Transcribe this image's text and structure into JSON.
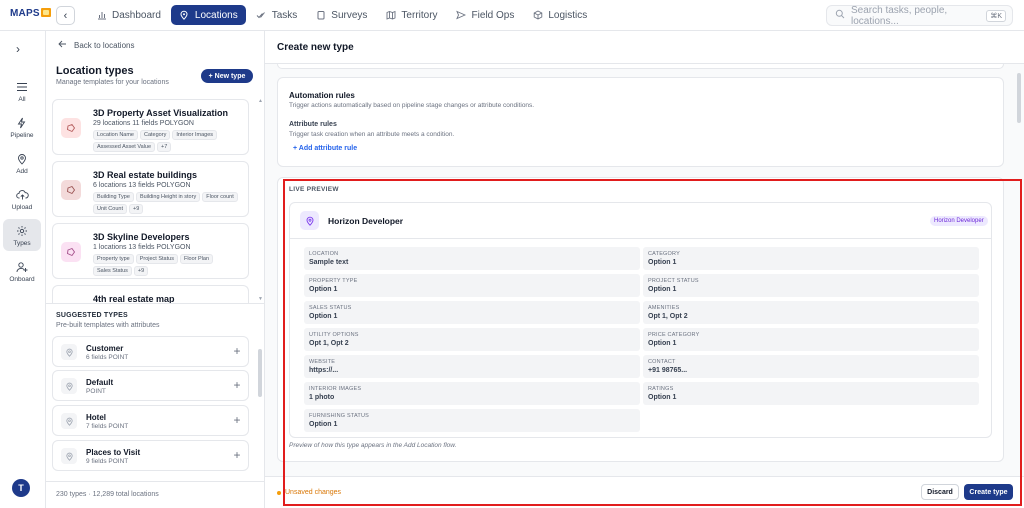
{
  "topbar": {
    "logo": "MAPS",
    "nav": [
      {
        "label": "Dashboard",
        "icon": "bar-chart-icon",
        "active": false
      },
      {
        "label": "Locations",
        "icon": "map-pin-icon",
        "active": true
      },
      {
        "label": "Tasks",
        "icon": "check-icon",
        "active": false
      },
      {
        "label": "Surveys",
        "icon": "clipboard-icon",
        "active": false
      },
      {
        "label": "Territory",
        "icon": "map-icon",
        "active": false
      },
      {
        "label": "Field Ops",
        "icon": "send-icon",
        "active": false
      },
      {
        "label": "Logistics",
        "icon": "box-icon",
        "active": false
      }
    ],
    "search_placeholder": "Search tasks, people, locations...",
    "search_shortcut": "⌘K"
  },
  "rail": {
    "items": [
      {
        "label": "All",
        "icon": "list-icon"
      },
      {
        "label": "Pipeline",
        "icon": "lightning-icon"
      },
      {
        "label": "Add",
        "icon": "map-pin-icon"
      },
      {
        "label": "Upload",
        "icon": "cloud-upload-icon"
      },
      {
        "label": "Types",
        "icon": "gear-icon",
        "active": true
      },
      {
        "label": "Onboard",
        "icon": "user-add-icon"
      }
    ],
    "avatar_initial": "T"
  },
  "left_panel": {
    "back_label": "Back to locations",
    "title": "Location types",
    "subtitle": "Manage templates for your locations",
    "new_type_label": "+ New type",
    "types": [
      {
        "name": "3D Property Asset Visualization",
        "meta": "29 locations  11 fields  POLYGON",
        "tags": [
          "Location Name",
          "Category",
          "Interior Images",
          "Assessed Asset Value",
          "+7"
        ],
        "icon_bg": "#fde2e2"
      },
      {
        "name": "3D Real estate buildings",
        "meta": "6 locations  13 fields  POLYGON",
        "tags": [
          "Building Type",
          "Building Height in story",
          "Floor count",
          "Unit Count",
          "+9"
        ],
        "icon_bg": "#f3dada"
      },
      {
        "name": "3D Skyline Developers",
        "meta": "1 locations  13 fields  POLYGON",
        "tags": [
          "Property type",
          "Project Status",
          "Floor Plan",
          "Sales Status",
          "+9"
        ],
        "icon_bg": "#fbe1f3"
      },
      {
        "name": "4th real estate map",
        "meta": "",
        "tags": [],
        "icon_bg": "#ffffff"
      }
    ],
    "suggested_title": "SUGGESTED TYPES",
    "suggested_subtitle": "Pre-built templates with attributes",
    "suggested": [
      {
        "name": "Customer",
        "meta": "6 fields  POINT"
      },
      {
        "name": "Default",
        "meta": "POINT"
      },
      {
        "name": "Hotel",
        "meta": "7 fields  POINT"
      },
      {
        "name": "Places to Visit",
        "meta": "9 fields  POINT"
      }
    ],
    "footer": "230 types · 12,289 total locations"
  },
  "main": {
    "title": "Create new type",
    "automation": {
      "title": "Automation rules",
      "description": "Trigger actions automatically based on pipeline stage changes or attribute conditions.",
      "attr_title": "Attribute rules",
      "attr_description": "Trigger task creation when an attribute meets a condition.",
      "add_rule": "+ Add attribute rule"
    },
    "preview": {
      "label": "LIVE PREVIEW",
      "name": "Horizon Developer",
      "badge": "Horizon Developer",
      "fields": [
        {
          "label": "LOCATION",
          "value": "Sample text"
        },
        {
          "label": "CATEGORY",
          "value": "Option 1"
        },
        {
          "label": "PROPERTY TYPE",
          "value": "Option 1"
        },
        {
          "label": "PROJECT STATUS",
          "value": "Option 1"
        },
        {
          "label": "SALES STATUS",
          "value": "Option 1"
        },
        {
          "label": "AMENITIES",
          "value": "Opt 1, Opt 2"
        },
        {
          "label": "UTILITY OPTIONS",
          "value": "Opt 1, Opt 2"
        },
        {
          "label": "PRICE CATEGORY",
          "value": "Option 1"
        },
        {
          "label": "WEBSITE",
          "value": "https://..."
        },
        {
          "label": "CONTACT",
          "value": "+91 98765..."
        },
        {
          "label": "INTERIOR IMAGES",
          "value": "1 photo"
        },
        {
          "label": "RATINGS",
          "value": "Option 1"
        },
        {
          "label": "FURNISHING STATUS",
          "value": "Option 1"
        }
      ],
      "caption": "Preview of how this type appears in the Add Location flow."
    },
    "footer": {
      "unsaved": "Unsaved changes",
      "discard": "Discard",
      "create": "Create type"
    }
  },
  "colors": {
    "brand": "#1e3a8a",
    "accent_purple": "#6d28d9",
    "warning": "#d97706",
    "highlight": "#e11d1d"
  }
}
